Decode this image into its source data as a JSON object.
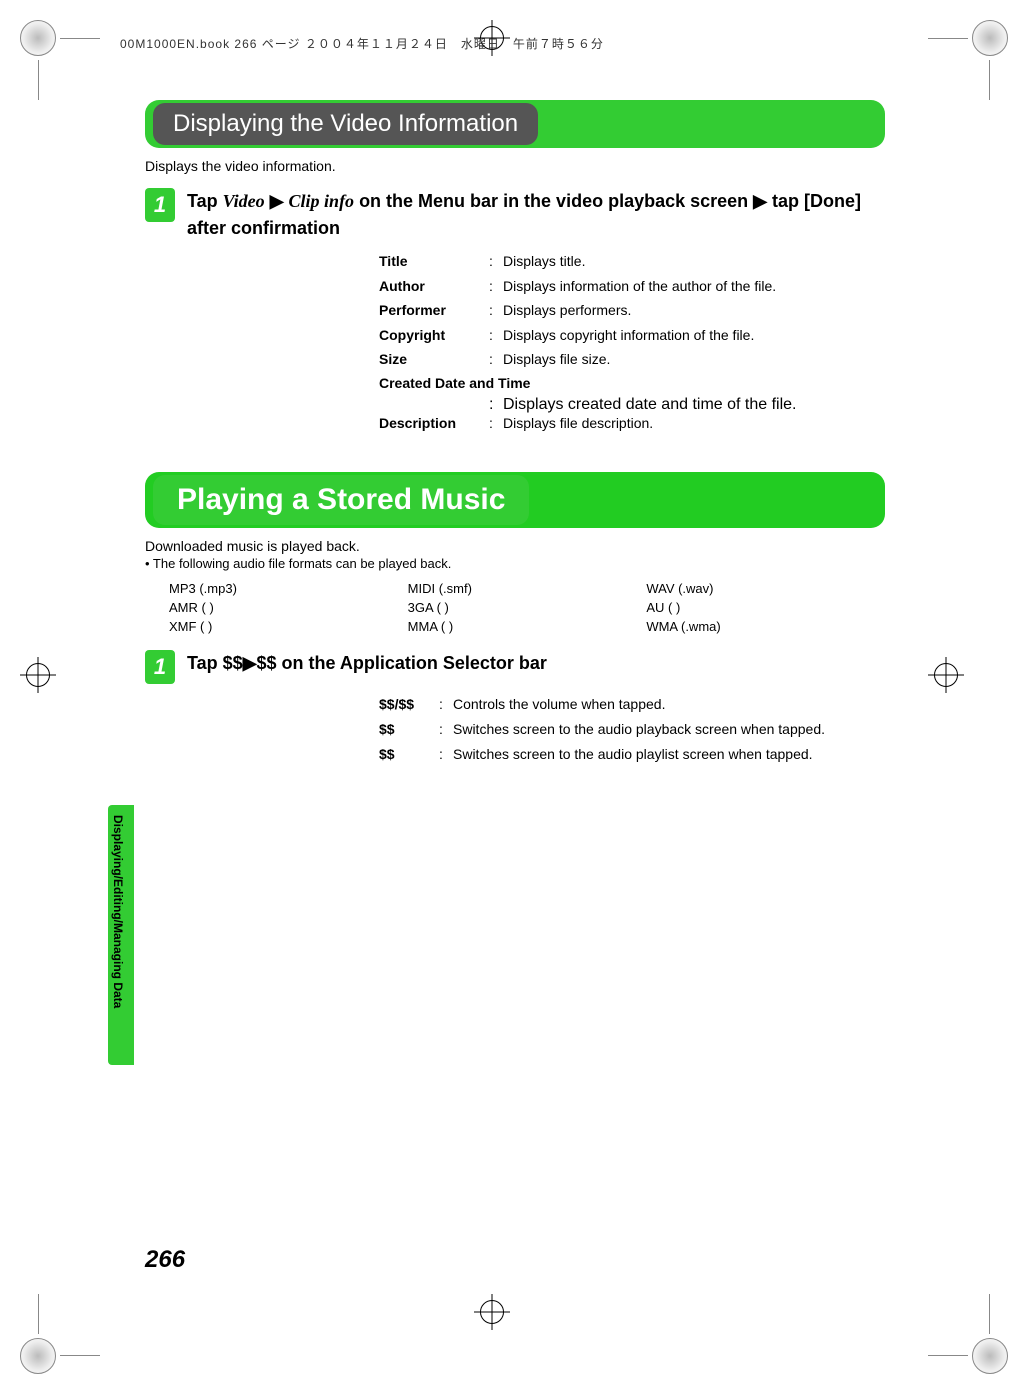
{
  "header_line": "00M1000EN.book  266 ページ  ２００４年１１月２４日　水曜日　午前７時５６分",
  "section1": {
    "title": "Displaying the Video Information",
    "intro": "Displays the video information.",
    "step_num": "1",
    "step_text_prefix": "Tap ",
    "step_text_italic1": "Video",
    "step_text_mid": " ▶ ",
    "step_text_italic2": "Clip info",
    "step_text_suffix": " on the Menu bar in the video playback screen ▶ tap [Done] after confirmation",
    "fields": {
      "title": {
        "label": "Title",
        "desc": "Displays title."
      },
      "author": {
        "label": "Author",
        "desc": "Displays information of the author of the file."
      },
      "performer": {
        "label": "Performer",
        "desc": "Displays performers."
      },
      "copyright": {
        "label": "Copyright",
        "desc": "Displays copyright information of the file."
      },
      "size": {
        "label": "Size",
        "desc": "Displays file size."
      },
      "created_label": "Created Date and Time",
      "created_desc": "Displays created date and time of the file.",
      "description": {
        "label": "Description",
        "desc": "Displays file description."
      }
    }
  },
  "section2": {
    "title": "Playing a Stored Music",
    "intro": "Downloaded music is played back.",
    "bullet": "• The following audio file formats can be played back.",
    "formats": {
      "c1r1": "MP3 (.mp3)",
      "c2r1": "MIDI (.smf)",
      "c3r1": "WAV (.wav)",
      "c1r2": "AMR ( )",
      "c2r2": "3GA ( )",
      "c3r2": "AU ( )",
      "c1r3": "XMF ( )",
      "c2r3": "MMA ( )",
      "c3r3": "WMA (.wma)"
    },
    "step_num": "1",
    "step_text": "Tap $$▶$$ on the Application Selector bar",
    "controls": {
      "vol": {
        "label": "$$/$$",
        "desc": "Controls the volume when tapped."
      },
      "playback": {
        "label": "$$",
        "desc": "Switches screen to the audio playback screen when tapped."
      },
      "playlist": {
        "label": "$$",
        "desc": "Switches screen to the audio playlist screen when tapped."
      }
    }
  },
  "side_tab": "Displaying/Editing/Managing Data",
  "page_number": "266"
}
